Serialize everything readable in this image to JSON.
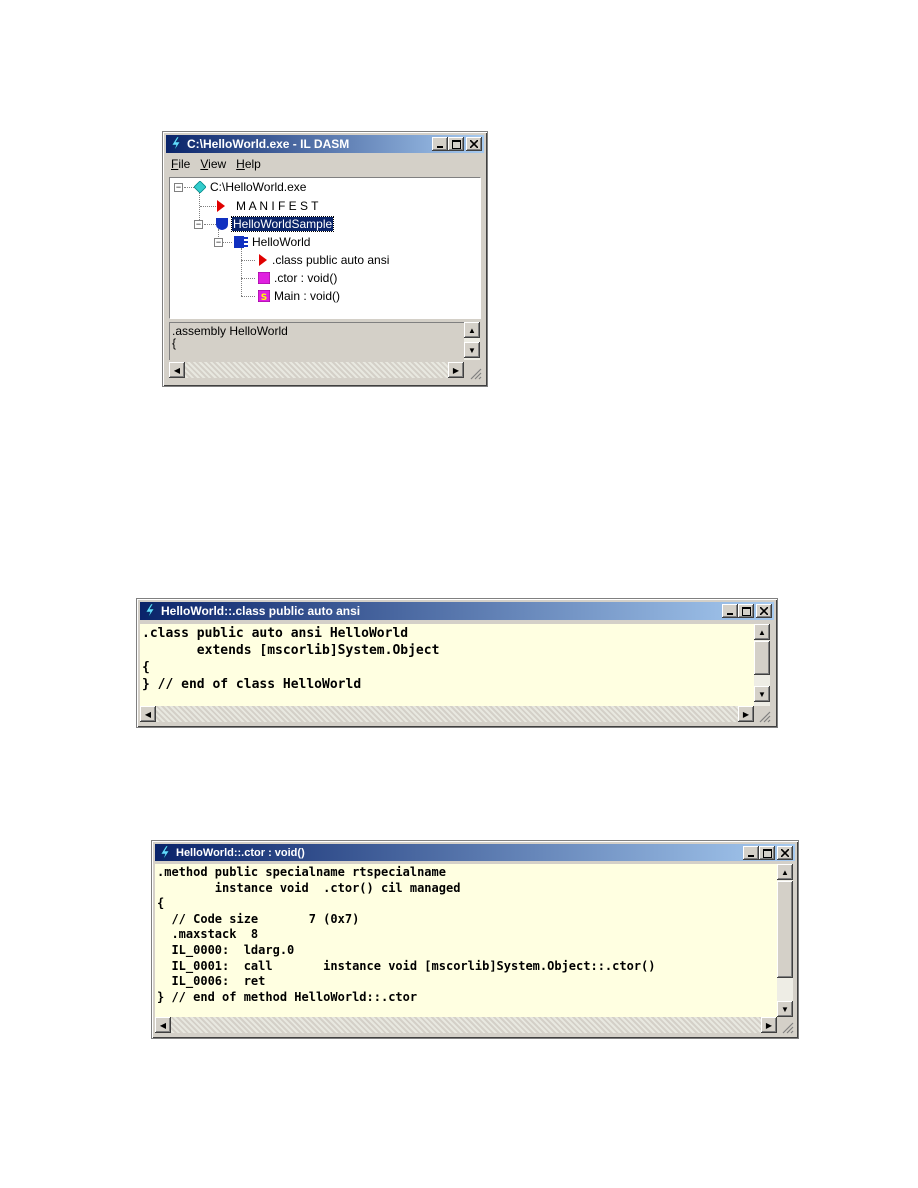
{
  "ildasm": {
    "title": "C:\\HelloWorld.exe - IL DASM",
    "menu": [
      {
        "label": "File",
        "key": "F",
        "rest": "ile"
      },
      {
        "label": "View",
        "key": "V",
        "rest": "iew"
      },
      {
        "label": "Help",
        "key": "H",
        "rest": "elp"
      }
    ],
    "tree": {
      "root": "C:\\HelloWorld.exe",
      "manifest": "M A N I F E S T",
      "namespace": "HelloWorldSample",
      "class": "HelloWorld",
      "class_decl": ".class public auto ansi",
      "ctor": ".ctor : void()",
      "main": "Main : void()"
    },
    "info_lines": [
      ".assembly HelloWorld",
      "{"
    ]
  },
  "class_window": {
    "title": "HelloWorld::.class public auto ansi",
    "code": ".class public auto ansi HelloWorld\n       extends [mscorlib]System.Object\n{\n} // end of class HelloWorld"
  },
  "ctor_window": {
    "title": "HelloWorld::.ctor : void()",
    "code": ".method public specialname rtspecialname\n        instance void  .ctor() cil managed\n{\n  // Code size       7 (0x7)\n  .maxstack  8\n  IL_0000:  ldarg.0\n  IL_0001:  call       instance void [mscorlib]System.Object::.ctor()\n  IL_0006:  ret\n} // end of method HelloWorld::.ctor"
  },
  "colors": {
    "title_start": "#0a246a",
    "title_end": "#a6caf0",
    "code_bg": "#ffffe1",
    "manifest_icon": "#e00000",
    "root_icon": "#33cccc",
    "namespace_icon": "#1030c0",
    "method_icon": "#e020e0"
  }
}
